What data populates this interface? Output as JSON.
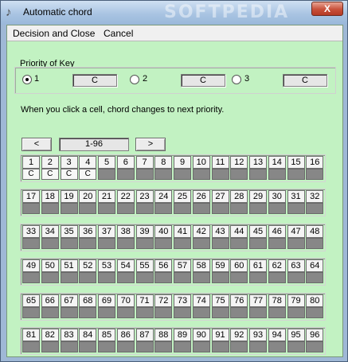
{
  "window": {
    "title": "Automatic chord",
    "watermark": "SOFTPEDIA",
    "close_glyph": "X",
    "app_icon": "music-note-icon"
  },
  "menu": {
    "items": [
      "Decision and Close",
      "Cancel"
    ]
  },
  "priority": {
    "title": "Priority of Key",
    "options": [
      {
        "label": "1",
        "value": "C",
        "checked": true
      },
      {
        "label": "2",
        "value": "C",
        "checked": false
      },
      {
        "label": "3",
        "value": "C",
        "checked": false
      }
    ]
  },
  "info_text": "When you click a cell, chord changes to next priority.",
  "nav": {
    "prev_label": "<",
    "range": "1-96",
    "next_label": ">"
  },
  "cells": {
    "chords": [
      "C",
      "C",
      "C",
      "C"
    ]
  },
  "colors": {
    "client_background": "#c2f2c2",
    "empty_chord_cell": "#878787"
  }
}
